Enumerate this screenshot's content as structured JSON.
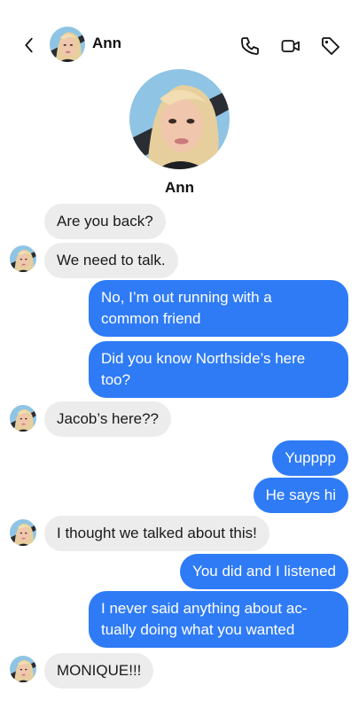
{
  "header": {
    "contact_name": "Ann",
    "icons": [
      "back-chevron-icon",
      "phone-icon",
      "video-icon",
      "tag-icon"
    ]
  },
  "profile": {
    "name": "Ann"
  },
  "messages": [
    {
      "from": "Ann",
      "text": "Are you back?"
    },
    {
      "from": "Ann",
      "text": "We need to talk."
    },
    {
      "from": "me",
      "lines": [
        "No, I’m out running with a",
        "common friend"
      ]
    },
    {
      "from": "me",
      "lines": [
        "Did you know Northside’s here",
        "too?"
      ]
    },
    {
      "from": "Ann",
      "text": "Jacob’s here??"
    },
    {
      "from": "me",
      "text": "Yupppp"
    },
    {
      "from": "me",
      "text": "He says hi"
    },
    {
      "from": "Ann",
      "text": "I thought we talked about this!"
    },
    {
      "from": "me",
      "text": "You did and I listened"
    },
    {
      "from": "me",
      "lines": [
        "I never said anything about ac-",
        "tually doing what you wanted"
      ]
    },
    {
      "from": "Ann",
      "text": "MONIQUE!!!"
    }
  ],
  "colors": {
    "outgoing": "#2f7bf6",
    "incoming": "#ececec"
  }
}
